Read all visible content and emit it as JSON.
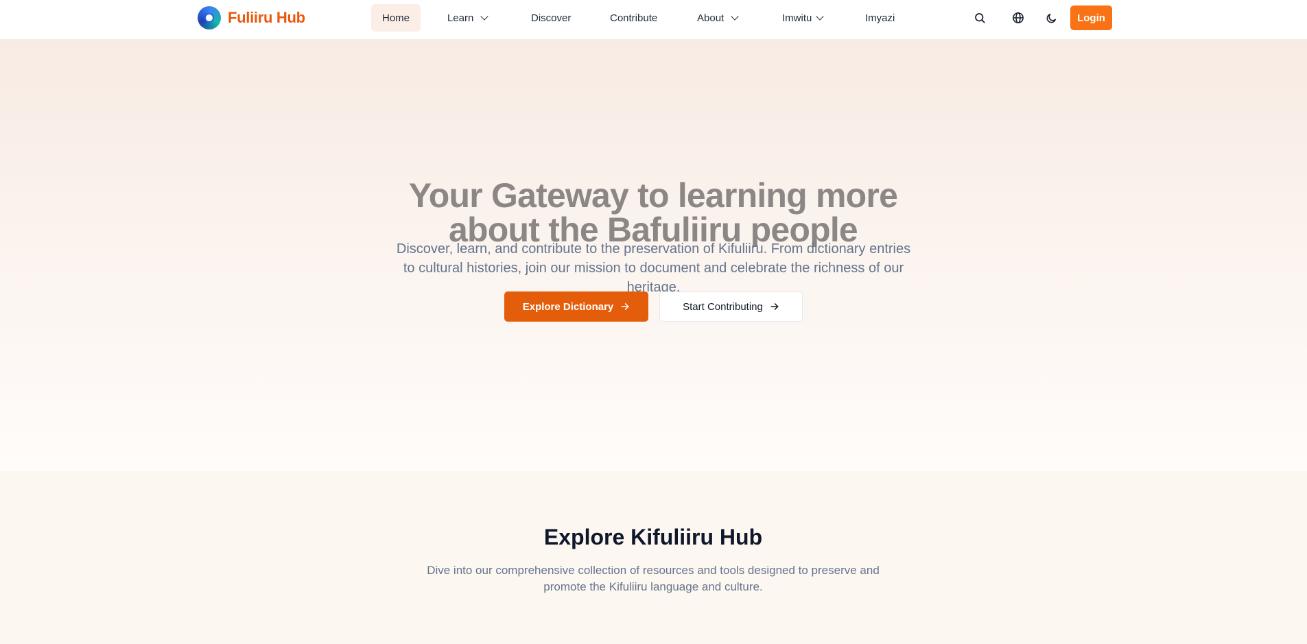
{
  "brand": {
    "name": "Fuliiru Hub"
  },
  "nav": {
    "items": [
      {
        "label": "Home",
        "active": true
      },
      {
        "label": "Learn",
        "dropdown": true
      },
      {
        "label": "Discover"
      },
      {
        "label": "Contribute"
      },
      {
        "label": "About",
        "dropdown": true
      },
      {
        "label": "Imwitu",
        "dropdown": true
      },
      {
        "label": "Imyazi"
      }
    ],
    "icons": [
      "search-icon",
      "globe-icon",
      "moon-icon"
    ],
    "login_label": "Login"
  },
  "hero": {
    "title": "Your Gateway to learning more about the Bafuliiru people",
    "subtitle": "Discover, learn, and contribute to the preservation of Kifuliiru. From dictionary entries to cultural histories, join our mission to document and celebrate the richness of our heritage.",
    "primary_button": "Explore Dictionary",
    "secondary_button": "Start Contributing"
  },
  "explore": {
    "title": "Explore Kifuliiru Hub",
    "subtitle": "Dive into our comprehensive collection of resources and tools designed to preserve and promote the Kifuliiru language and culture."
  },
  "colors": {
    "accent": "#ea580c",
    "button_primary": "#e35d0b",
    "login": "#f97316"
  }
}
